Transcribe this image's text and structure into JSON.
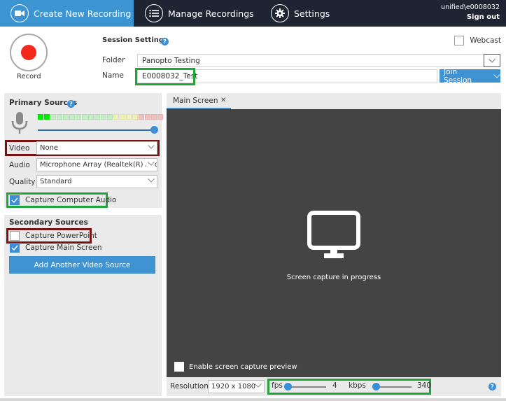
{
  "nav": {
    "tabs": [
      {
        "label": "Create New Recording",
        "icon": "video-camera-icon",
        "active": true
      },
      {
        "label": "Manage Recordings",
        "icon": "list-icon",
        "active": false
      },
      {
        "label": "Settings",
        "icon": "gear-icon",
        "active": false
      }
    ],
    "user": "unified\\e0008032",
    "sign_out": "Sign out"
  },
  "record": {
    "label": "Record"
  },
  "session": {
    "title": "Session Settings",
    "help": "?",
    "webcast_label": "Webcast",
    "webcast_checked": false,
    "folder_label": "Folder",
    "folder_value": "Panopto Testing",
    "name_label": "Name",
    "name_value": "E0008032_Test",
    "join_label": "Join Session",
    "caret": "﹀"
  },
  "primary": {
    "title": "Primary Sources",
    "help": "?",
    "level_meter": {
      "segments": 20,
      "active_segments": 2,
      "colors": {
        "active": "#00ee00",
        "green": "#c6ecc6",
        "yellow": "#efefb8",
        "red": "#f0c0c0"
      }
    },
    "volume_fraction": 1.0,
    "video_label": "Video",
    "video_value": "None",
    "audio_label": "Audio",
    "audio_value": "Microphone Array (Realtek(R) Audio)",
    "quality_label": "Quality",
    "quality_value": "Standard",
    "capture_computer_audio_label": "Capture Computer Audio",
    "capture_computer_audio_checked": true
  },
  "secondary": {
    "title": "Secondary Sources",
    "capture_ppt_label": "Capture PowerPoint",
    "capture_ppt_checked": false,
    "capture_main_screen_label": "Capture Main Screen",
    "capture_main_screen_checked": true,
    "add_source_label": "Add Another Video Source"
  },
  "preview": {
    "tab_label": "Main Screen",
    "tab_close": "✕",
    "status_text": "Screen capture in progress",
    "enable_preview_label": "Enable screen capture preview",
    "enable_preview_checked": false
  },
  "bottom": {
    "resolution_label": "Resolution",
    "resolution_value": "1920 x 1080",
    "fps_label": "fps",
    "fps_value": "4",
    "kbps_label": "kbps",
    "kbps_value": "340",
    "help": "?"
  },
  "colors": {
    "nav_bg": "#1e2432",
    "accent": "#3c95d2",
    "record_red": "#f2291b",
    "highlight_green": "#1fa53a",
    "highlight_red": "#7a1212",
    "preview_bg": "#444444"
  }
}
